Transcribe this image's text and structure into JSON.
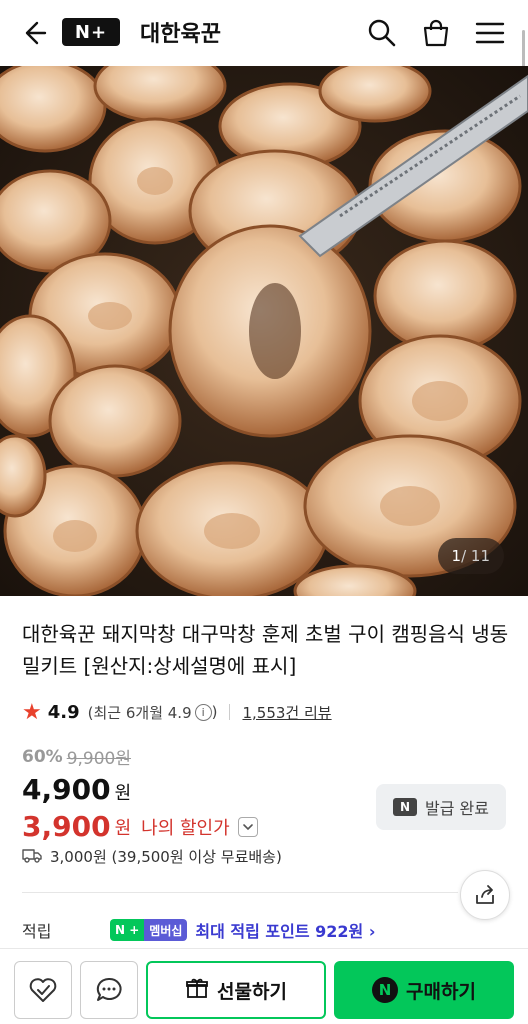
{
  "header": {
    "logo_text": "N+",
    "store_name": "대한육꾼",
    "icons": [
      "back-arrow-icon",
      "search-icon",
      "shopping-bag-icon",
      "menu-icon"
    ]
  },
  "hero": {
    "image_index": "1",
    "image_total": "/ 11"
  },
  "product": {
    "title": "대한육꾼 돼지막창 대구막창 훈제 초벌 구이 캠핑음식 냉동 밀키트 [원산지:상세설명에 표시]",
    "rating": "4.9",
    "rating_detail": "(최근 6개월 4.9",
    "info_glyph": "i",
    "rating_close": ")",
    "review_count": "1,553건 리뷰"
  },
  "price": {
    "discount_rate": "60%",
    "original_price": "9,900원",
    "sale_price": "4,900",
    "sale_unit": "원",
    "my_price": "3,900",
    "my_unit": "원",
    "my_label": "나의 할인가"
  },
  "coupon": {
    "badge": "N",
    "label": "발급 완료"
  },
  "shipping": {
    "text": "3,000원 (39,500원 이상 무료배송)"
  },
  "points": {
    "label": "적립",
    "badge_np": "N +",
    "badge_member": "멤버십",
    "text": "최대 적립 포인트 922원 ›"
  },
  "bottom_bar": {
    "gift_label": "선물하기",
    "buy_badge": "N",
    "buy_label": "구매하기"
  },
  "colors": {
    "brand_green": "#03c75a",
    "sale_red": "#d3342d",
    "point_blue": "#3a3ad0"
  }
}
